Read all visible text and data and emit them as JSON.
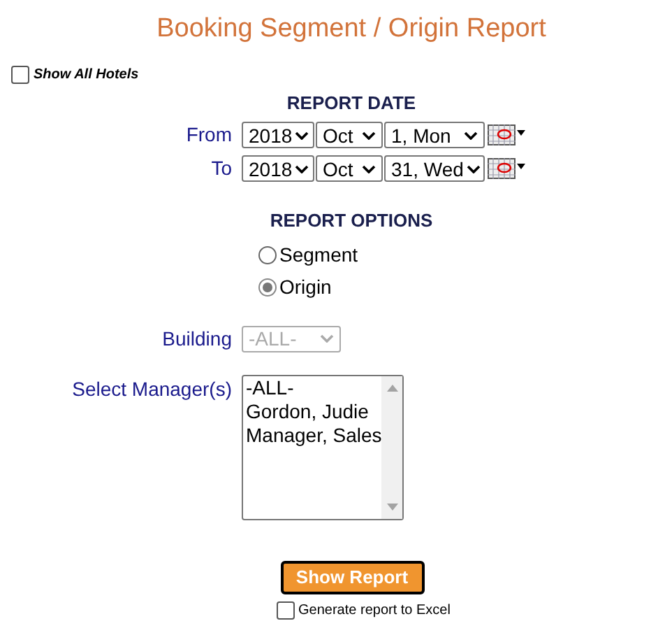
{
  "title": "Booking Segment / Origin Report",
  "show_all_hotels": {
    "label": "Show All Hotels",
    "checked": false
  },
  "report_date": {
    "heading": "REPORT DATE",
    "rows": [
      {
        "label": "From",
        "year": "2018",
        "month": "Oct",
        "day": "1, Mon"
      },
      {
        "label": "To",
        "year": "2018",
        "month": "Oct",
        "day": "31, Wed"
      }
    ]
  },
  "report_options": {
    "heading": "REPORT OPTIONS",
    "options": [
      {
        "label": "Segment",
        "selected": false
      },
      {
        "label": "Origin",
        "selected": true
      }
    ]
  },
  "building": {
    "label": "Building",
    "value": "-ALL-",
    "disabled": true
  },
  "managers": {
    "label": "Select Manager(s)",
    "items": [
      "-ALL-",
      "Gordon, Judie",
      "Manager, Sales"
    ]
  },
  "show_report_button": "Show Report",
  "excel": {
    "label": "Generate report to Excel",
    "checked": false
  }
}
